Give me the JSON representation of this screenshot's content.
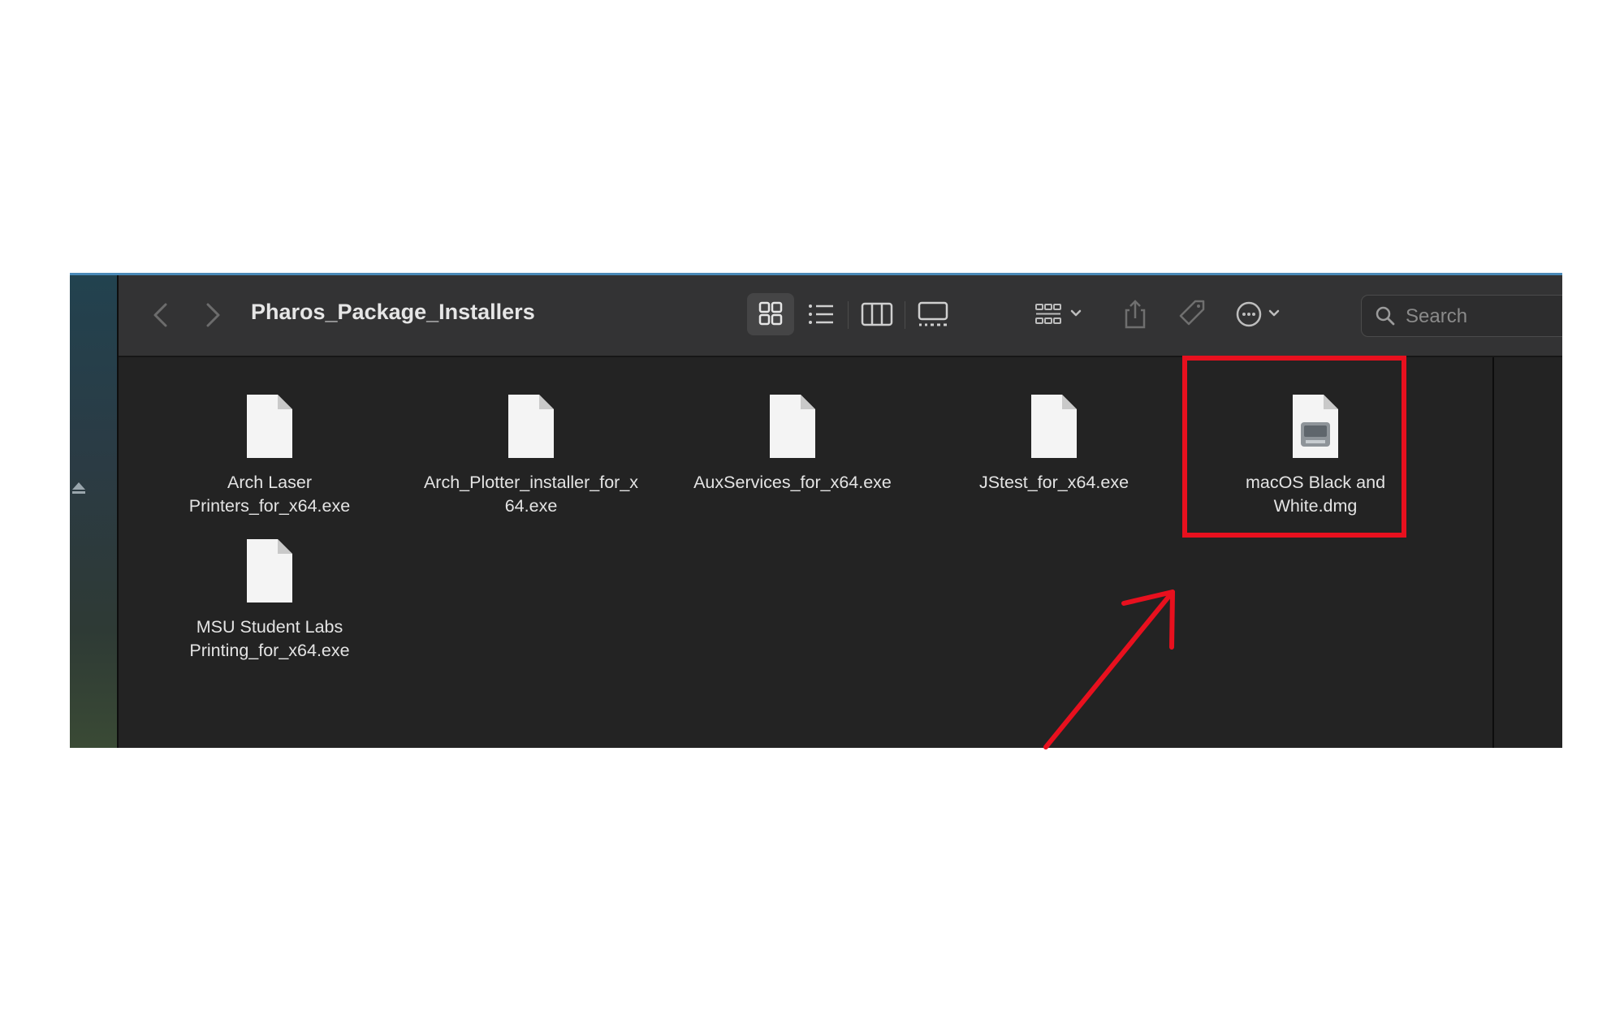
{
  "window": {
    "title": "Pharos_Package_Installers"
  },
  "toolbar": {
    "back_icon": "chevron-left-icon",
    "forward_icon": "chevron-right-icon",
    "views": [
      "grid-view-icon",
      "list-view-icon",
      "column-view-icon",
      "gallery-view-icon"
    ],
    "active_view": "grid-view-icon",
    "group_icon": "group-by-icon",
    "share_icon": "share-icon",
    "tag_icon": "tag-icon",
    "more_icon": "more-actions-icon"
  },
  "search": {
    "placeholder": "Search",
    "value": ""
  },
  "files": [
    {
      "name": "Arch Laser\nPrinters_for_x64.exe",
      "kind": "document"
    },
    {
      "name": "Arch_Plotter_installer_for_x\n64.exe",
      "kind": "document"
    },
    {
      "name": "AuxServices_for_x64.exe",
      "kind": "document"
    },
    {
      "name": "JStest_for_x64.exe",
      "kind": "document"
    },
    {
      "name": "macOS Black and\nWhite.dmg",
      "kind": "disk-image",
      "highlighted": true
    },
    {
      "name": "MSU Student Labs\nPrinting_for_x64.exe",
      "kind": "document"
    }
  ],
  "annotation": {
    "highlight_color": "#e8101e",
    "arrow_color": "#e8101e"
  }
}
